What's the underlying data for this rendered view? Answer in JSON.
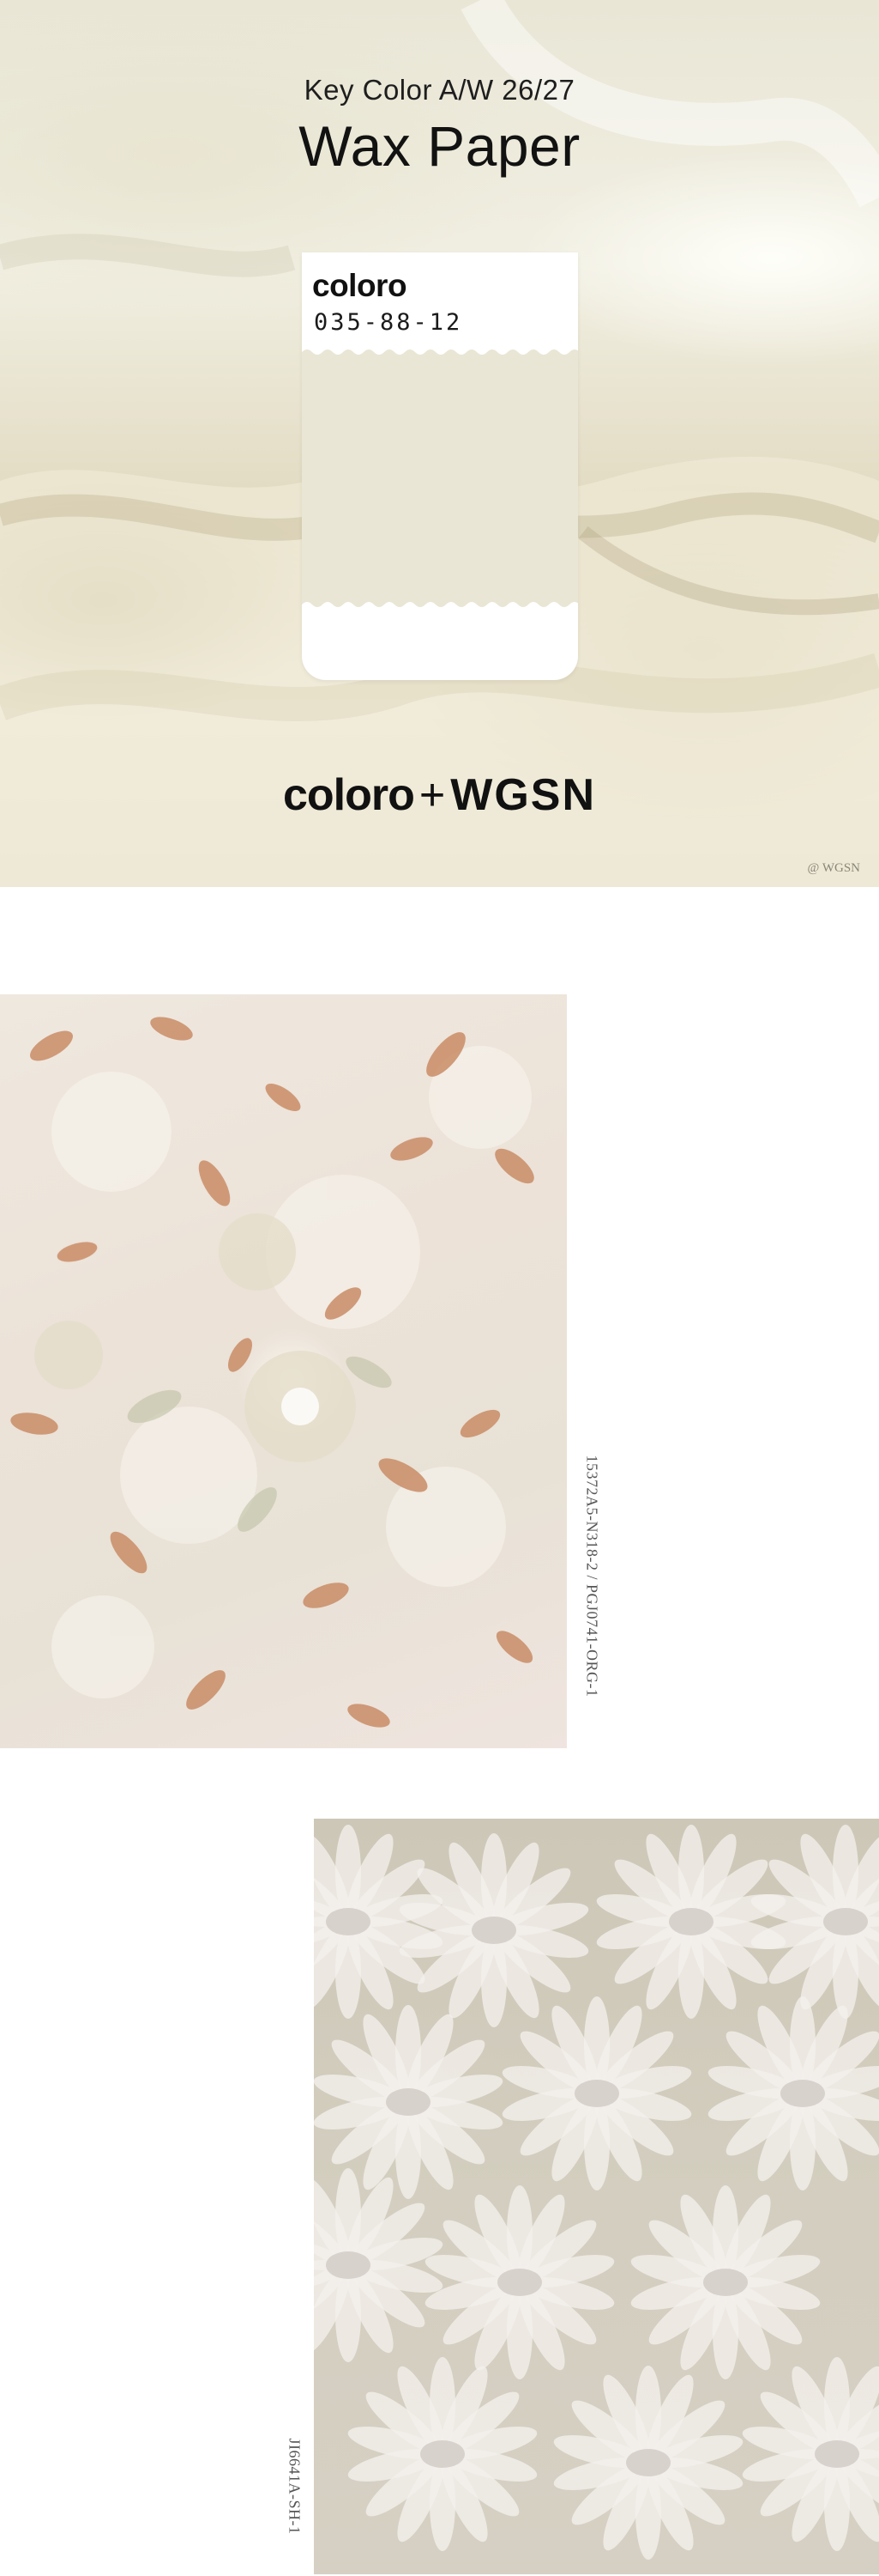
{
  "hero": {
    "subtitle": "Key Color A/W 26/27",
    "title": "Wax Paper",
    "swatch_brand": "coloro",
    "swatch_code": "035-88-12",
    "logo_coloro": "coloro",
    "logo_plus": "+",
    "logo_wgsn": "WGSN",
    "credit": "@ WGSN"
  },
  "fabrics": [
    {
      "code": "15372A5-N318-2 / PGJ0741-ORG-1"
    },
    {
      "code": "JI6641A-SH-1"
    }
  ],
  "colors": {
    "swatch": "#e9e6d5",
    "leaf": "#c98c66",
    "sequin": "#f3f0ec"
  }
}
